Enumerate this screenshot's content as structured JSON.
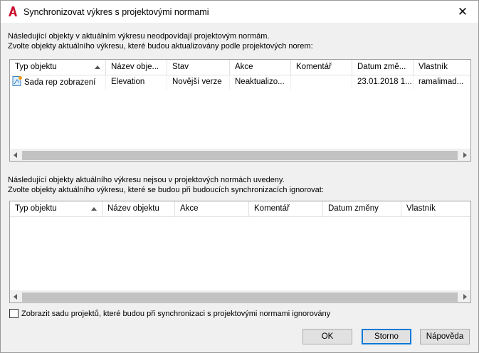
{
  "window": {
    "title": "Synchronizovat výkres s projektovými normami",
    "close_glyph": "✕",
    "app_icon": "autocad-a-icon"
  },
  "top_section": {
    "line1": "Následující objekty v aktuálním výkresu neodpovídají projektovým normám.",
    "line2": "Zvolte objekty aktuálního výkresu, které budou aktualizovány podle projektových norem:",
    "columns": [
      "Typ objektu",
      "Název obje...",
      "Stav",
      "Akce",
      "Komentář",
      "Datum změ...",
      "Vlastník"
    ],
    "rows": [
      {
        "icon": "property-set-icon",
        "cells": [
          "Sada rep zobrazení",
          "Elevation",
          "Novější verze",
          "Neaktualizo...",
          "",
          "23.01.2018 1...",
          "ramalimad..."
        ]
      }
    ]
  },
  "bottom_section": {
    "line1": "Následující objekty aktuálního výkresu nejsou v projektových normách uvedeny.",
    "line2": "Zvolte objekty aktuálního výkresu, které se budou při budoucích synchronizacích ignorovat:",
    "columns": [
      "Typ objektu",
      "Název objektu",
      "Akce",
      "Komentář",
      "Datum změny",
      "Vlastník"
    ]
  },
  "checkbox": {
    "label": "Zobrazit sadu projektů, které budou při synchronizaci s projektovými normami ignorovány",
    "checked": false
  },
  "buttons": {
    "ok": "OK",
    "cancel": "Storno",
    "help": "Nápověda"
  },
  "colors": {
    "accent": "#0078d7",
    "app_icon_red": "#c8102e"
  }
}
